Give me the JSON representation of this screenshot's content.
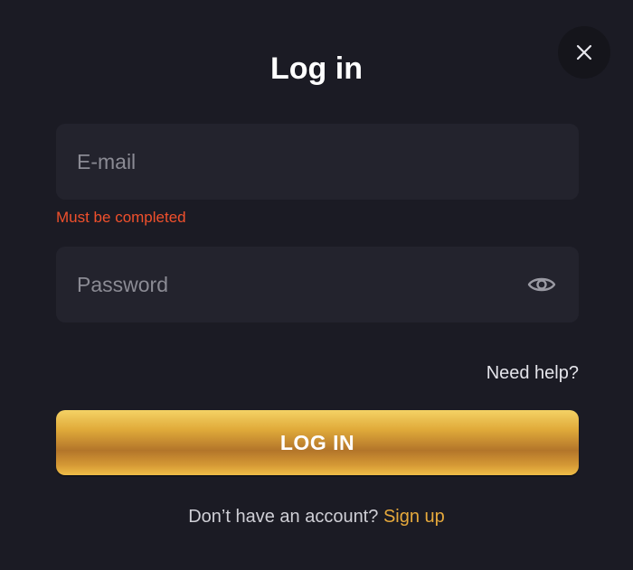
{
  "modal": {
    "title": "Log in",
    "close_icon": "close-icon"
  },
  "email": {
    "placeholder": "E-mail",
    "value": "",
    "error": "Must be completed"
  },
  "password": {
    "placeholder": "Password",
    "value": "",
    "toggle_icon": "eye-icon"
  },
  "links": {
    "need_help": "Need help?",
    "no_account": "Don’t have an account?",
    "sign_up": "Sign up"
  },
  "buttons": {
    "login_label": "LOG IN"
  },
  "colors": {
    "background": "#1b1b24",
    "field_bg": "#23232d",
    "error": "#f0502c",
    "accent_gold": "#e6a93c",
    "text_white": "#ffffff"
  }
}
